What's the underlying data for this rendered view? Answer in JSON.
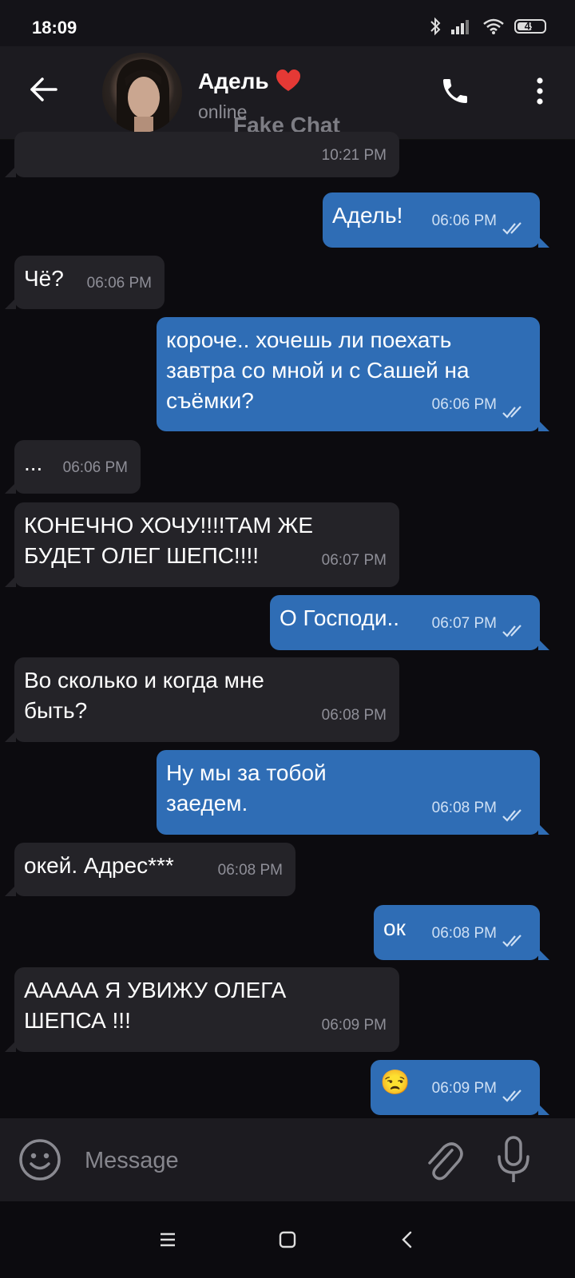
{
  "status_bar": {
    "time": "18:09",
    "battery": "49"
  },
  "header": {
    "contact_name": "Адель",
    "status": "online",
    "watermark": "Fake Chat"
  },
  "messages": [
    {
      "dir": "in",
      "text": "",
      "time": "10:21 PM"
    },
    {
      "dir": "out",
      "text": "Адель!",
      "time": "06:06 PM"
    },
    {
      "dir": "in",
      "text": "Чё?",
      "time": "06:06 PM"
    },
    {
      "dir": "out",
      "text": "короче.. хочешь ли поехать\nзавтра со мной и с Сашей на\nсъёмки?",
      "time": "06:06 PM"
    },
    {
      "dir": "in",
      "text": "...",
      "time": "06:06 PM"
    },
    {
      "dir": "in",
      "text": "КОНЕЧНО ХОЧУ!!!!ТАМ ЖЕ\nБУДЕТ ОЛЕГ ШЕПС!!!!",
      "time": "06:07 PM"
    },
    {
      "dir": "out",
      "text": "О Господи..",
      "time": "06:07 PM"
    },
    {
      "dir": "in",
      "text": "Во сколько и когда мне\nбыть?",
      "time": "06:08 PM"
    },
    {
      "dir": "out",
      "text": "Ну мы за тобой\nзаедем.",
      "time": "06:08 PM"
    },
    {
      "dir": "in",
      "text": "окей. Адрес***",
      "time": "06:08 PM"
    },
    {
      "dir": "out",
      "text": "ок",
      "time": "06:08 PM"
    },
    {
      "dir": "in",
      "text": "ААААА Я УВИЖУ ОЛЕГА\nШЕПСА !!!",
      "time": "06:09 PM"
    },
    {
      "dir": "out",
      "text": "😒",
      "time": "06:09 PM"
    }
  ],
  "input": {
    "placeholder": "Message"
  },
  "icons": {
    "back": "arrow-left-icon",
    "heart": "heart-icon",
    "call": "phone-icon",
    "menu": "more-vertical-icon",
    "emoji": "smile-icon",
    "attach": "paperclip-icon",
    "mic": "microphone-icon",
    "read": "double-check-icon",
    "nav_recent": "menu-lines-icon",
    "nav_home": "square-icon",
    "nav_back": "chevron-left-icon"
  },
  "colors": {
    "background": "#0c0b0f",
    "incoming_bubble": "#242328",
    "outgoing_bubble": "#2f6db5",
    "header": "#1c1b20",
    "heart": "#e53935"
  }
}
